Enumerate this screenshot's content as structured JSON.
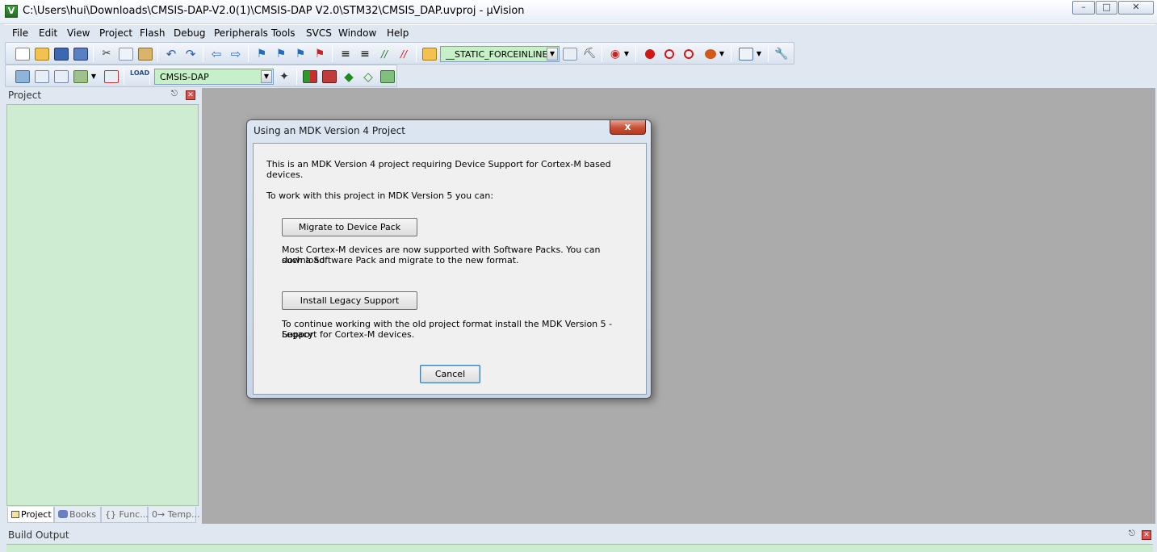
{
  "window": {
    "title": "C:\\Users\\hui\\Downloads\\CMSIS-DAP-V2.0(1)\\CMSIS-DAP V2.0\\STM32\\CMSIS_DAP.uvproj - µVision",
    "app_icon_letter": "V"
  },
  "menu": [
    "File",
    "Edit",
    "View",
    "Project",
    "Flash",
    "Debug",
    "Peripherals",
    "Tools",
    "SVCS",
    "Window",
    "Help"
  ],
  "toolbar1": {
    "define_combo": "__STATIC_FORCEINLINE"
  },
  "toolbar2": {
    "target_combo": "CMSIS-DAP"
  },
  "project_panel": {
    "title": "Project",
    "tabs": [
      {
        "label": "Project",
        "icon": "project-icon"
      },
      {
        "label": "Books",
        "icon": "books-icon"
      },
      {
        "label": "{} Func...",
        "icon": "functions-icon"
      },
      {
        "label": "0→ Temp...",
        "icon": "templates-icon"
      }
    ]
  },
  "build_output": {
    "title": "Build Output"
  },
  "dialog": {
    "title": "Using an MDK Version 4 Project",
    "close_glyph": "x",
    "intro": "This is an MDK Version 4 project requiring Device Support for Cortex-M based devices.",
    "prompt": "To work with this project in MDK Version 5 you can:",
    "migrate_button": "Migrate to Device Pack",
    "migrate_desc_line1": "Most Cortex-M devices are now supported with Software Packs. You can download",
    "migrate_desc_line2": "such a Software Pack and migrate to the new format.",
    "legacy_button": "Install Legacy Support",
    "legacy_desc_line1": "To continue working with the old project format install the MDK Version 5 - Legacy",
    "legacy_desc_line2": "Support for Cortex-M devices.",
    "cancel_button": "Cancel"
  },
  "colors": {
    "panel_green": "#cdecd2",
    "editor_gray": "#ababab",
    "chrome": "#dfe7f1",
    "breakpoint_red": "#d01818"
  }
}
